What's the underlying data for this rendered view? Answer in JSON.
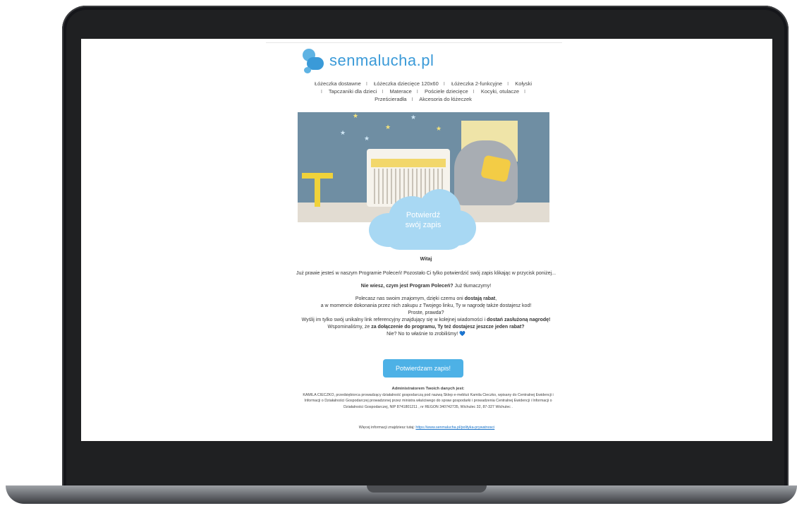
{
  "logo": {
    "text": "senmalucha.pl"
  },
  "nav": [
    "Łóżeczka dostawne",
    "Łóżeczka dziecięce 120x60",
    "Łóżeczka 2-funkcyjne",
    "Kołyski",
    "Tapczaniki dla dzieci",
    "Materace",
    "Pościele dziecięce",
    "Kocyki, otulacze",
    "Prześcieradła",
    "Akcesoria do łóżeczek"
  ],
  "hero": {
    "cloud_line1": "Potwierdź",
    "cloud_line2": "swój zapis"
  },
  "body": {
    "greeting": "Witaj",
    "intro": "Już prawie jesteś w naszym Programie Poleceń! Pozostało Ci tylko potwierdzić swój zapis klikając w przycisk poniżej...",
    "question_bold": "Nie wiesz, czym jest Program Poleceń?",
    "question_rest": " Już tłumaczymy!",
    "p1_start": "Polecasz nas swoim znajomym, dzięki czemu oni ",
    "p1_bold": "dostają rabat",
    "p1_end": ",",
    "p2": "a w momencie dokonania przez nich zakupu z Twojego linku, Ty w nagrodę także dostajesz kod!",
    "p3": "Proste, prawda?",
    "p4_start": "Wyślij im tylko swój unikalny link referencyjny znajdujący się w kolejnej wiadomości i ",
    "p4_bold": "dostań zasłużoną nagrodę!",
    "p4_mid": " Wspominaliśmy, że ",
    "p4_bold2": "za dołączenie do programu, Ty też dostajesz jeszcze jeden rabat?",
    "p5": "Nie? No to właśnie to zrobiliśmy! ",
    "heart": "💙"
  },
  "button": {
    "label": "Potwierdzam zapis!"
  },
  "admin": {
    "heading": "Administratorem Twoich danych jest:",
    "text": "KAMILA CIECZKO, przedsiębiorca prowadzący działalność gospodarczą pod nazwą Sklep e-mebluś Kamila Cieczko, wpisany do Centralnej Ewidencji i Informacji o Działalności Gospodarczej prowadzonej przez ministra właściwego do spraw gospodarki i prowadzenia Centralnej Ewidencji i Informacji o Działalności Gospodarczej, NIP 8741801211 , nr REGON 340742735, Wichulec 32, 87-327 Wichulec ."
  },
  "more": {
    "text": "Więcej informacji znajdziesz tutaj: ",
    "link": "https://www.senmalucha.pl/polityka-prywatnosci"
  },
  "colors": {
    "accent": "#4db1e6",
    "cloud": "#a8d8f3",
    "logo": "#3a9ad8"
  }
}
